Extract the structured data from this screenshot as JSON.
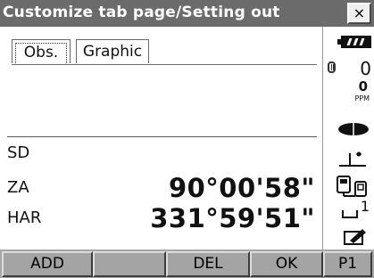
{
  "title": "Customize tab page/Setting out",
  "close_label": "×",
  "tabs": [
    {
      "label": "Obs."
    },
    {
      "label": "Graphic"
    }
  ],
  "rows": [
    {
      "label": "SD",
      "value": ""
    },
    {
      "label": "ZA",
      "value": "90°00'58\""
    },
    {
      "label": "HAR",
      "value": "331°59'51\""
    }
  ],
  "status": {
    "prism_constant": "0",
    "ppm_value": "0",
    "ppm_label": "PPM",
    "input_mode": "1"
  },
  "softkeys": [
    "ADD",
    "",
    "DEL",
    "OK",
    "P1"
  ],
  "colors": {
    "titlebar": "#6b6b6b",
    "softkey_bar": "#a7a7a7",
    "background": "#ffffff"
  }
}
